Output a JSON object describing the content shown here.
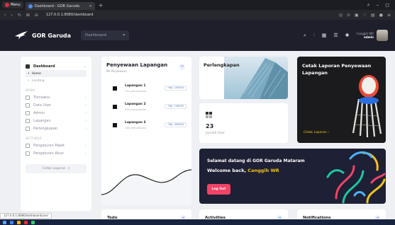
{
  "browser": {
    "menu_label": "Menu",
    "tab_title": "Dashboard - GOR Garuda",
    "url": "127.0.0.1:8080/dashboard",
    "new_tab": "+",
    "tab_close": "×",
    "status_url": "127.0.0.1:8080/dashboard/user"
  },
  "header": {
    "brand": "GOR Garuda",
    "dashboard_select": "Dashboard",
    "user_greeting": "Canggih WR",
    "user_role": "admin"
  },
  "sidebar": {
    "dashboard": "Dashboard",
    "sub_items": [
      "Home",
      "Landing"
    ],
    "menu_section": "MENU",
    "menu_items": [
      "Transaksi",
      "Data User",
      "Admin",
      "Lapangan",
      "Perlengkapan"
    ],
    "settings_section": "SETTINGS",
    "settings_items": [
      "Pengaturan Paket",
      "Pengaturan Akun"
    ],
    "print_button": "Cetak Laporan"
  },
  "rental": {
    "title": "Penyewaan Lapangan",
    "subtitle": "89 Penyewaan",
    "courts": [
      {
        "name": "Lapangan 1",
        "count": "31x penyewaan",
        "price": "+Rp. 100000"
      },
      {
        "name": "Lapangan 2",
        "count": "42x penyewaan",
        "price": "+Rp. 140000"
      },
      {
        "name": "Lapangan 3",
        "count": "16x penyewaan",
        "price": "+Rp. 490000"
      }
    ]
  },
  "equipment": {
    "title": "Perlengkapan"
  },
  "users": {
    "count": "23",
    "label": "Jumlah User"
  },
  "print": {
    "title": "Cetak Laporan Penyewaan Lapangan",
    "link": "Cetak Laporan"
  },
  "welcome": {
    "line1": "Selamat datang di GOR Garuda Mataram",
    "line2_prefix": "Welcome back, ",
    "line2_name": "Canggih WR",
    "logout": "Log Out"
  },
  "bottom": [
    "Todo",
    "Activities",
    "Notifications"
  ],
  "colors": {
    "accent": "#f24467",
    "highlight": "#f3c21b",
    "dark": "#1e1f2b"
  }
}
